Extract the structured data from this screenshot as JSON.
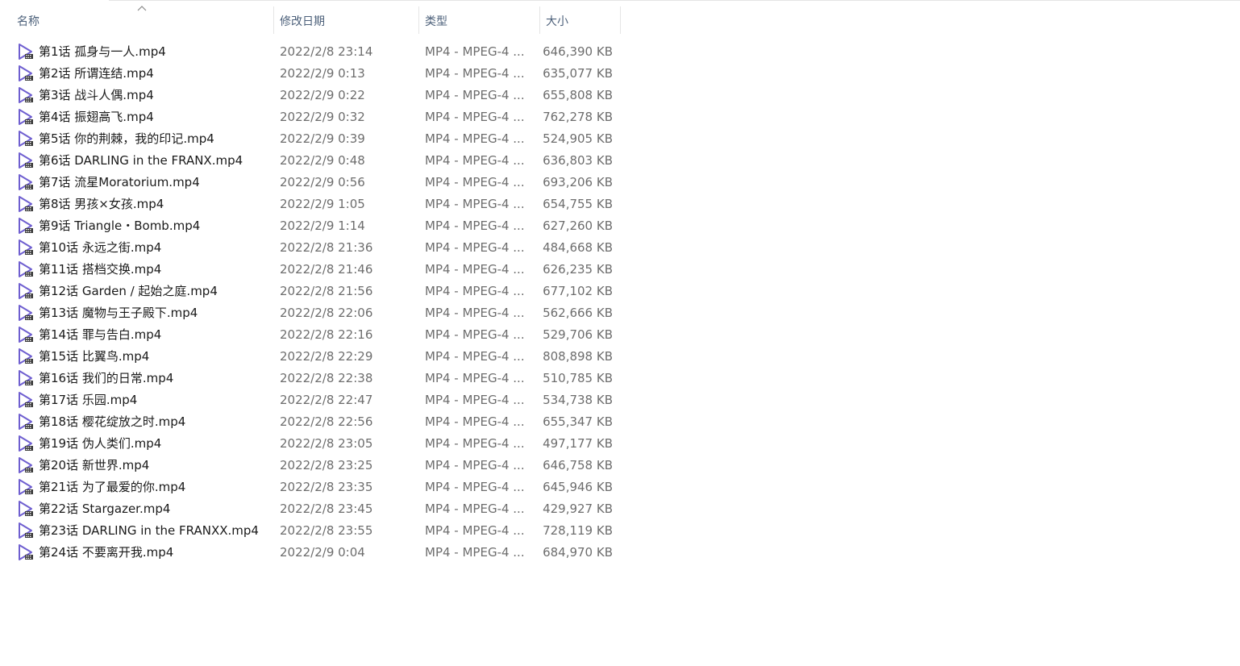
{
  "columns": {
    "name": "名称",
    "date": "修改日期",
    "type": "类型",
    "size": "大小"
  },
  "sort": {
    "column": "name",
    "direction": "ascending",
    "icon": "chevron-up-icon"
  },
  "file_icon": "video-play-icon",
  "files": [
    {
      "name": "第1话 孤身与一人.mp4",
      "date": "2022/2/8 23:14",
      "type": "MP4 - MPEG-4 ...",
      "size": "646,390 KB"
    },
    {
      "name": "第2话 所谓连结.mp4",
      "date": "2022/2/9 0:13",
      "type": "MP4 - MPEG-4 ...",
      "size": "635,077 KB"
    },
    {
      "name": "第3话 战斗人偶.mp4",
      "date": "2022/2/9 0:22",
      "type": "MP4 - MPEG-4 ...",
      "size": "655,808 KB"
    },
    {
      "name": "第4话 振翅高飞.mp4",
      "date": "2022/2/9 0:32",
      "type": "MP4 - MPEG-4 ...",
      "size": "762,278 KB"
    },
    {
      "name": "第5话 你的荆棘，我的印记.mp4",
      "date": "2022/2/9 0:39",
      "type": "MP4 - MPEG-4 ...",
      "size": "524,905 KB"
    },
    {
      "name": "第6话 DARLING in the FRANX.mp4",
      "date": "2022/2/9 0:48",
      "type": "MP4 - MPEG-4 ...",
      "size": "636,803 KB"
    },
    {
      "name": "第7话 流星Moratorium.mp4",
      "date": "2022/2/9 0:56",
      "type": "MP4 - MPEG-4 ...",
      "size": "693,206 KB"
    },
    {
      "name": "第8话 男孩×女孩.mp4",
      "date": "2022/2/9 1:05",
      "type": "MP4 - MPEG-4 ...",
      "size": "654,755 KB"
    },
    {
      "name": "第9话 Triangle・Bomb.mp4",
      "date": "2022/2/9 1:14",
      "type": "MP4 - MPEG-4 ...",
      "size": "627,260 KB"
    },
    {
      "name": "第10话 永远之街.mp4",
      "date": "2022/2/8 21:36",
      "type": "MP4 - MPEG-4 ...",
      "size": "484,668 KB"
    },
    {
      "name": "第11话 搭档交换.mp4",
      "date": "2022/2/8 21:46",
      "type": "MP4 - MPEG-4 ...",
      "size": "626,235 KB"
    },
    {
      "name": "第12话 Garden / 起始之庭.mp4",
      "date": "2022/2/8 21:56",
      "type": "MP4 - MPEG-4 ...",
      "size": "677,102 KB"
    },
    {
      "name": "第13话 魔物与王子殿下.mp4",
      "date": "2022/2/8 22:06",
      "type": "MP4 - MPEG-4 ...",
      "size": "562,666 KB"
    },
    {
      "name": "第14话 罪与告白.mp4",
      "date": "2022/2/8 22:16",
      "type": "MP4 - MPEG-4 ...",
      "size": "529,706 KB"
    },
    {
      "name": "第15话 比翼鸟.mp4",
      "date": "2022/2/8 22:29",
      "type": "MP4 - MPEG-4 ...",
      "size": "808,898 KB"
    },
    {
      "name": "第16话 我们的日常.mp4",
      "date": "2022/2/8 22:38",
      "type": "MP4 - MPEG-4 ...",
      "size": "510,785 KB"
    },
    {
      "name": "第17话 乐园.mp4",
      "date": "2022/2/8 22:47",
      "type": "MP4 - MPEG-4 ...",
      "size": "534,738 KB"
    },
    {
      "name": "第18话 樱花绽放之时.mp4",
      "date": "2022/2/8 22:56",
      "type": "MP4 - MPEG-4 ...",
      "size": "655,347 KB"
    },
    {
      "name": "第19话 伪人类们.mp4",
      "date": "2022/2/8 23:05",
      "type": "MP4 - MPEG-4 ...",
      "size": "497,177 KB"
    },
    {
      "name": "第20话 新世界.mp4",
      "date": "2022/2/8 23:25",
      "type": "MP4 - MPEG-4 ...",
      "size": "646,758 KB"
    },
    {
      "name": "第21话 为了最爱的你.mp4",
      "date": "2022/2/8 23:35",
      "type": "MP4 - MPEG-4 ...",
      "size": "645,946 KB"
    },
    {
      "name": "第22话 Stargazer.mp4",
      "date": "2022/2/8 23:45",
      "type": "MP4 - MPEG-4 ...",
      "size": "429,927 KB"
    },
    {
      "name": "第23话 DARLING in the FRANXX.mp4",
      "date": "2022/2/8 23:55",
      "type": "MP4 - MPEG-4 ...",
      "size": "728,119 KB"
    },
    {
      "name": "第24话 不要离开我.mp4",
      "date": "2022/2/9 0:04",
      "type": "MP4 - MPEG-4 ...",
      "size": "684,970 KB"
    }
  ]
}
